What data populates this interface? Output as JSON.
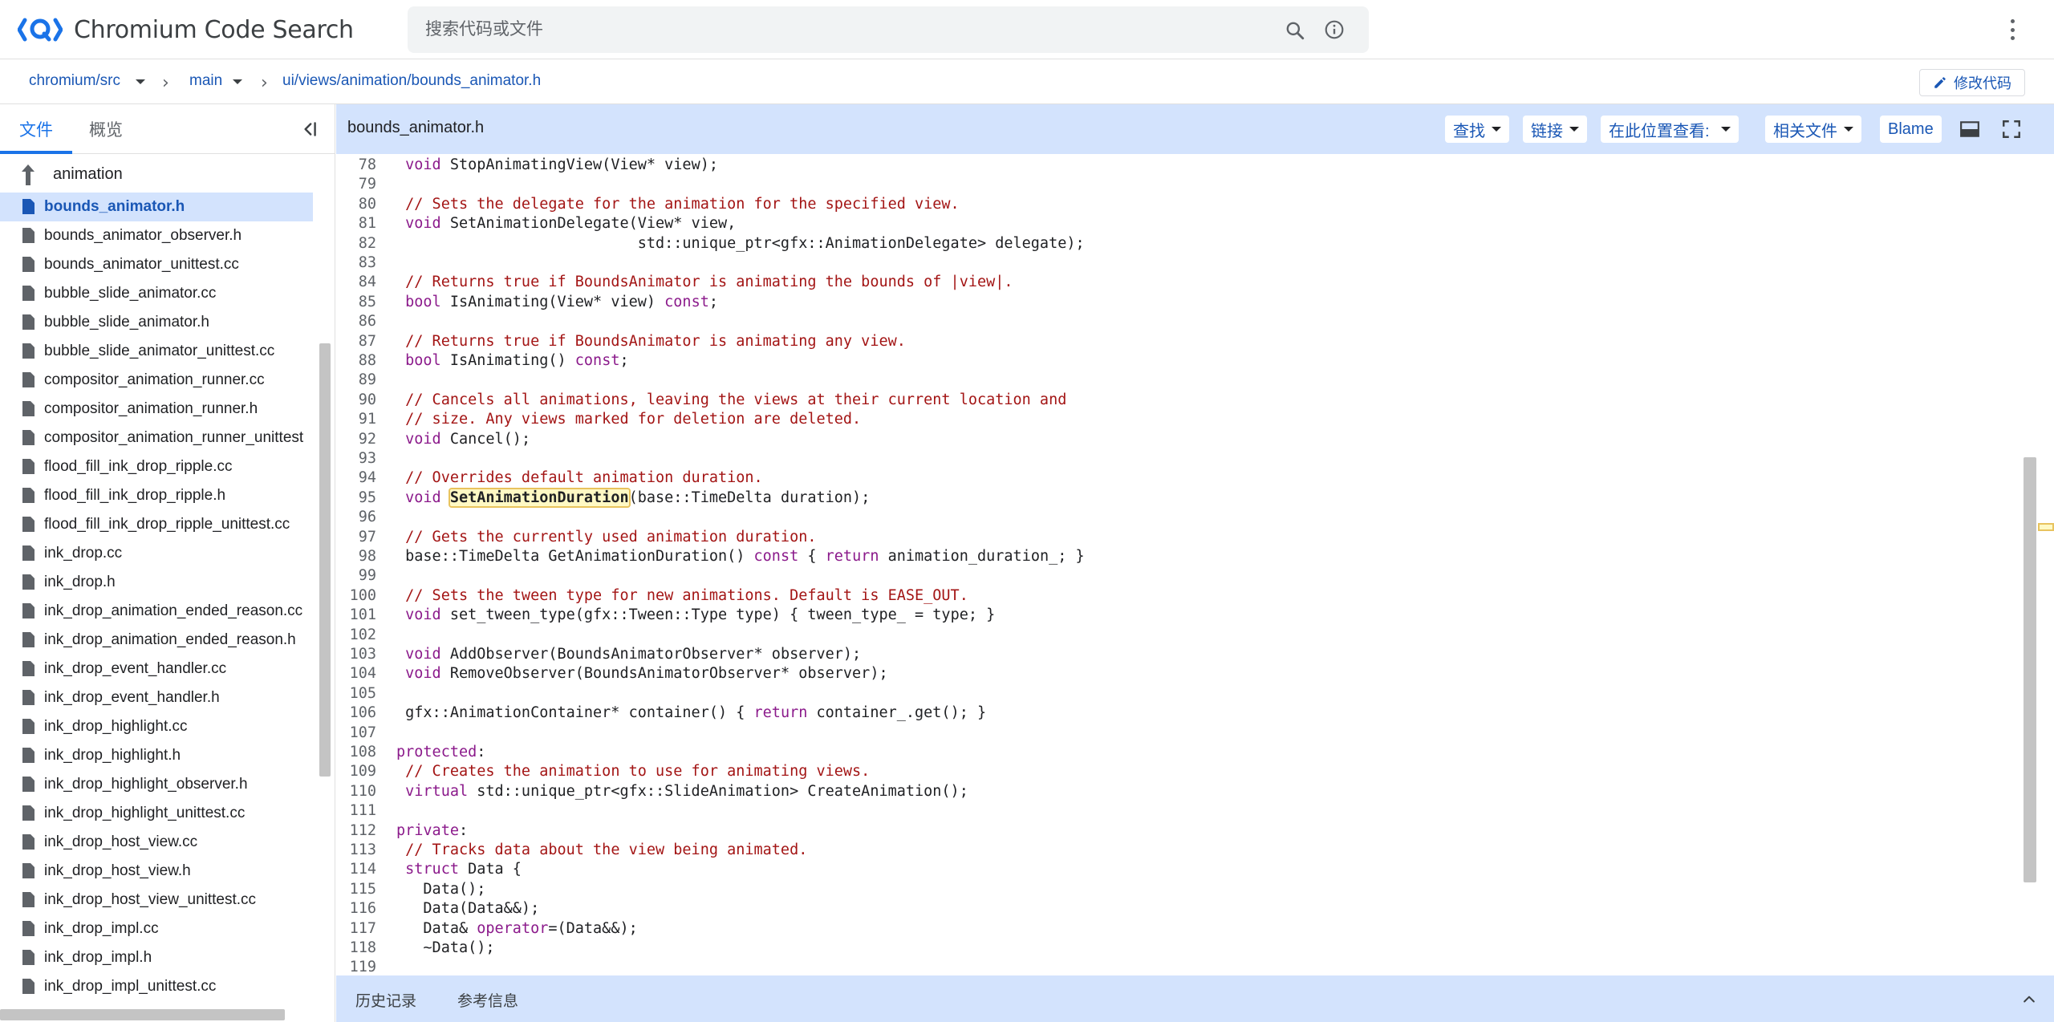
{
  "app": {
    "title": "Chromium Code Search",
    "brand_color": "#1a73e8"
  },
  "search": {
    "placeholder": "搜索代码或文件",
    "icons": [
      "search-icon",
      "info-icon"
    ]
  },
  "breadcrumb": {
    "repo": "chromium/src",
    "branch": "main",
    "path": "ui/views/animation/bounds_animator.h",
    "edit_label": "修改代码"
  },
  "sidebar": {
    "tabs": [
      {
        "label": "文件",
        "active": true
      },
      {
        "label": "概览",
        "active": false
      }
    ],
    "parent_folder": "animation",
    "files": [
      {
        "name": "bounds_animator.h",
        "active": true
      },
      {
        "name": "bounds_animator_observer.h",
        "active": false
      },
      {
        "name": "bounds_animator_unittest.cc",
        "active": false
      },
      {
        "name": "bubble_slide_animator.cc",
        "active": false
      },
      {
        "name": "bubble_slide_animator.h",
        "active": false
      },
      {
        "name": "bubble_slide_animator_unittest.cc",
        "active": false
      },
      {
        "name": "compositor_animation_runner.cc",
        "active": false
      },
      {
        "name": "compositor_animation_runner.h",
        "active": false
      },
      {
        "name": "compositor_animation_runner_unittest",
        "active": false
      },
      {
        "name": "flood_fill_ink_drop_ripple.cc",
        "active": false
      },
      {
        "name": "flood_fill_ink_drop_ripple.h",
        "active": false
      },
      {
        "name": "flood_fill_ink_drop_ripple_unittest.cc",
        "active": false
      },
      {
        "name": "ink_drop.cc",
        "active": false
      },
      {
        "name": "ink_drop.h",
        "active": false
      },
      {
        "name": "ink_drop_animation_ended_reason.cc",
        "active": false
      },
      {
        "name": "ink_drop_animation_ended_reason.h",
        "active": false
      },
      {
        "name": "ink_drop_event_handler.cc",
        "active": false
      },
      {
        "name": "ink_drop_event_handler.h",
        "active": false
      },
      {
        "name": "ink_drop_highlight.cc",
        "active": false
      },
      {
        "name": "ink_drop_highlight.h",
        "active": false
      },
      {
        "name": "ink_drop_highlight_observer.h",
        "active": false
      },
      {
        "name": "ink_drop_highlight_unittest.cc",
        "active": false
      },
      {
        "name": "ink_drop_host_view.cc",
        "active": false
      },
      {
        "name": "ink_drop_host_view.h",
        "active": false
      },
      {
        "name": "ink_drop_host_view_unittest.cc",
        "active": false
      },
      {
        "name": "ink_drop_impl.cc",
        "active": false
      },
      {
        "name": "ink_drop_impl.h",
        "active": false
      },
      {
        "name": "ink_drop_impl_unittest.cc",
        "active": false
      }
    ]
  },
  "code_header": {
    "filename": "bounds_animator.h",
    "find_label": "查找",
    "link_label": "链接",
    "view_at_label": "在此位置查看:",
    "related_label": "相关文件",
    "blame_label": "Blame"
  },
  "code": {
    "highlight_symbol": "SetAnimationDuration",
    "lines": [
      {
        "n": "78",
        "t": "  void StopAnimatingView(View* view);"
      },
      {
        "n": "79",
        "t": ""
      },
      {
        "n": "80",
        "t": "  // Sets the delegate for the animation for the specified view."
      },
      {
        "n": "81",
        "t": "  void SetAnimationDelegate(View* view,"
      },
      {
        "n": "82",
        "t": "                            std::unique_ptr<gfx::AnimationDelegate> delegate);"
      },
      {
        "n": "83",
        "t": ""
      },
      {
        "n": "84",
        "t": "  // Returns true if BoundsAnimator is animating the bounds of |view|."
      },
      {
        "n": "85",
        "t": "  bool IsAnimating(View* view) const;"
      },
      {
        "n": "86",
        "t": ""
      },
      {
        "n": "87",
        "t": "  // Returns true if BoundsAnimator is animating any view."
      },
      {
        "n": "88",
        "t": "  bool IsAnimating() const;"
      },
      {
        "n": "89",
        "t": ""
      },
      {
        "n": "90",
        "t": "  // Cancels all animations, leaving the views at their current location and"
      },
      {
        "n": "91",
        "t": "  // size. Any views marked for deletion are deleted."
      },
      {
        "n": "92",
        "t": "  void Cancel();"
      },
      {
        "n": "93",
        "t": ""
      },
      {
        "n": "94",
        "t": "  // Overrides default animation duration."
      },
      {
        "n": "95",
        "t": "  void SetAnimationDuration(base::TimeDelta duration);"
      },
      {
        "n": "96",
        "t": ""
      },
      {
        "n": "97",
        "t": "  // Gets the currently used animation duration."
      },
      {
        "n": "98",
        "t": "  base::TimeDelta GetAnimationDuration() const { return animation_duration_; }"
      },
      {
        "n": "99",
        "t": ""
      },
      {
        "n": "100",
        "t": "  // Sets the tween type for new animations. Default is EASE_OUT."
      },
      {
        "n": "101",
        "t": "  void set_tween_type(gfx::Tween::Type type) { tween_type_ = type; }"
      },
      {
        "n": "102",
        "t": ""
      },
      {
        "n": "103",
        "t": "  void AddObserver(BoundsAnimatorObserver* observer);"
      },
      {
        "n": "104",
        "t": "  void RemoveObserver(BoundsAnimatorObserver* observer);"
      },
      {
        "n": "105",
        "t": ""
      },
      {
        "n": "106",
        "t": "  gfx::AnimationContainer* container() { return container_.get(); }"
      },
      {
        "n": "107",
        "t": ""
      },
      {
        "n": "108",
        "t": " protected:"
      },
      {
        "n": "109",
        "t": "  // Creates the animation to use for animating views."
      },
      {
        "n": "110",
        "t": "  virtual std::unique_ptr<gfx::SlideAnimation> CreateAnimation();"
      },
      {
        "n": "111",
        "t": ""
      },
      {
        "n": "112",
        "t": " private:"
      },
      {
        "n": "113",
        "t": "  // Tracks data about the view being animated."
      },
      {
        "n": "114",
        "t": "  struct Data {"
      },
      {
        "n": "115",
        "t": "    Data();"
      },
      {
        "n": "116",
        "t": "    Data(Data&&);"
      },
      {
        "n": "117",
        "t": "    Data& operator=(Data&&);"
      },
      {
        "n": "118",
        "t": "    ~Data();"
      },
      {
        "n": "119",
        "t": ""
      }
    ]
  },
  "bottom": {
    "tabs": [
      "历史记录",
      "参考信息"
    ]
  }
}
